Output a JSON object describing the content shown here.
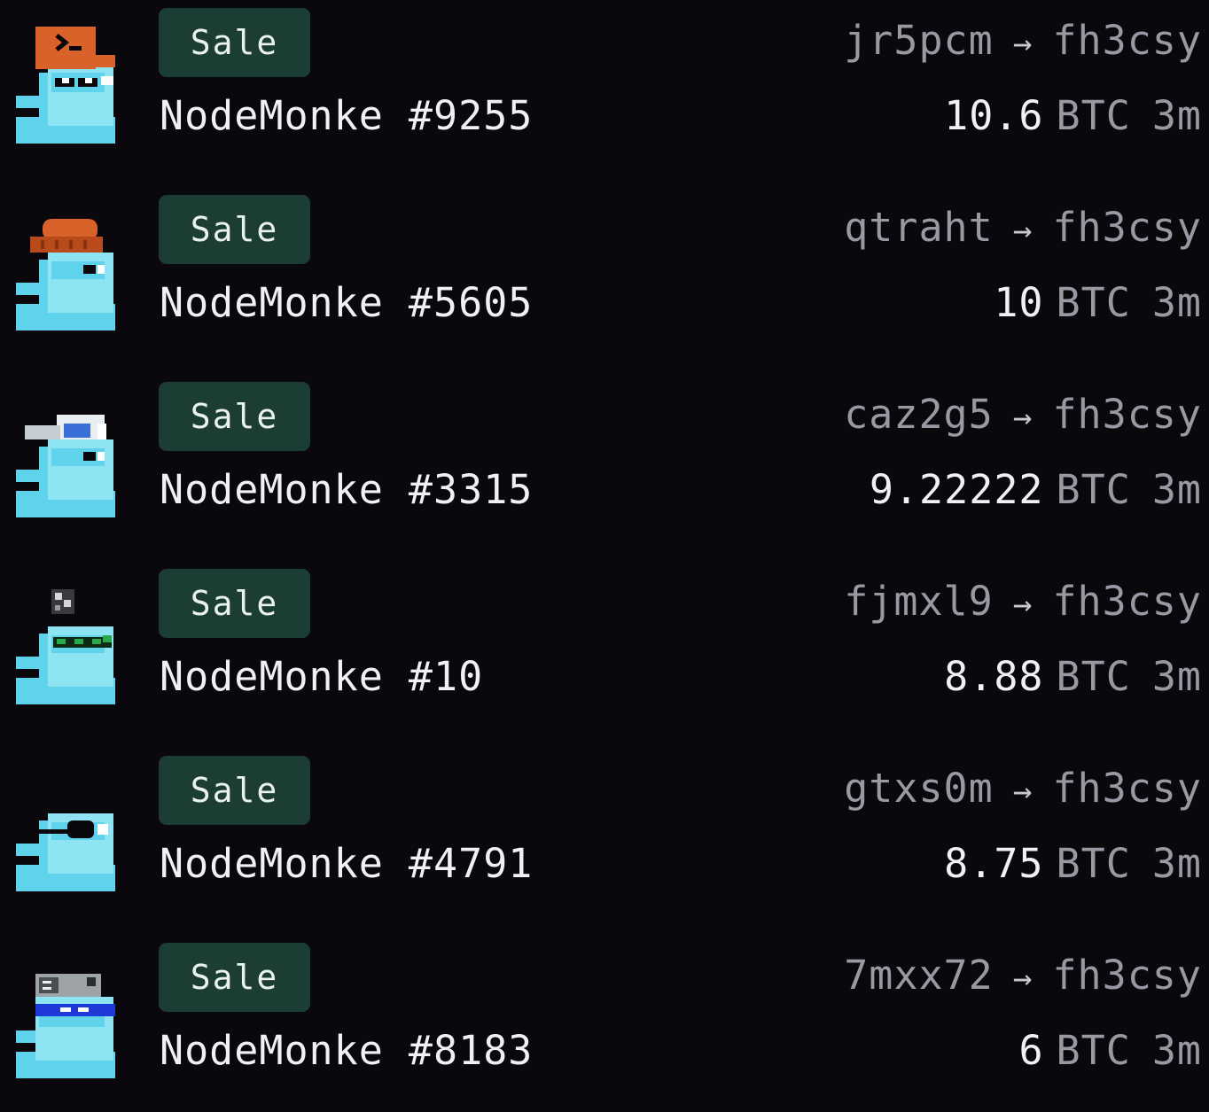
{
  "feed": {
    "items": [
      {
        "badge": "Sale",
        "name": "NodeMonke #9255",
        "from": "jr5pcm",
        "arrow": "→",
        "to": "fh3csy",
        "price": "10.6",
        "unit": "BTC",
        "time": "3m",
        "accessory": "orange-terminal-cap",
        "accessory_color": "#d9622b"
      },
      {
        "badge": "Sale",
        "name": "NodeMonke #5605",
        "from": "qtraht",
        "arrow": "→",
        "to": "fh3csy",
        "price": "10",
        "unit": "BTC",
        "time": "3m",
        "accessory": "orange-beanie",
        "accessory_color": "#d9622b"
      },
      {
        "badge": "Sale",
        "name": "NodeMonke #3315",
        "from": "caz2g5",
        "arrow": "→",
        "to": "fh3csy",
        "price": "9.22222",
        "unit": "BTC",
        "time": "3m",
        "accessory": "white-blue-cap",
        "accessory_color": "#3a6fd8"
      },
      {
        "badge": "Sale",
        "name": "NodeMonke #10",
        "from": "fjmxl9",
        "arrow": "→",
        "to": "fh3csy",
        "price": "8.88",
        "unit": "BTC",
        "time": "3m",
        "accessory": "green-visor-glasses",
        "accessory_color": "#2aa84a"
      },
      {
        "badge": "Sale",
        "name": "NodeMonke #4791",
        "from": "gtxs0m",
        "arrow": "→",
        "to": "fh3csy",
        "price": "8.75",
        "unit": "BTC",
        "time": "3m",
        "accessory": "eyepatch",
        "accessory_color": "#111111"
      },
      {
        "badge": "Sale",
        "name": "NodeMonke #8183",
        "from": "7mxx72",
        "arrow": "→",
        "to": "fh3csy",
        "price": "6",
        "unit": "BTC",
        "time": "3m",
        "accessory": "blue-visor-hat",
        "accessory_color": "#1f39d8"
      }
    ]
  },
  "colors": {
    "background": "#0a080d",
    "badge_bg": "#1c3d33",
    "monke_body": "#5fd3ec",
    "monke_face": "#8ee4f2",
    "text_primary": "#f2f0f5",
    "text_muted": "#9b98a4"
  }
}
